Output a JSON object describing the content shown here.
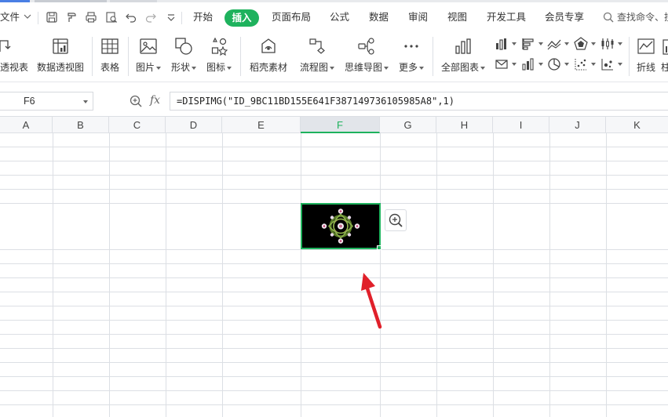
{
  "menu": {
    "file": "文件",
    "tabs": [
      "开始",
      "插入",
      "页面布局",
      "公式",
      "数据",
      "审阅",
      "视图",
      "开发工具",
      "会员专享"
    ],
    "active_tab": "插入",
    "search": "查找命令、搜"
  },
  "ribbon": {
    "pivot_table": "透视表",
    "pivot_chart": "数据透视图",
    "table": "表格",
    "picture": "图片",
    "shape": "形状",
    "icon": "图标",
    "stock_material": "稻壳素材",
    "flowchart": "流程图",
    "mindmap": "思维导图",
    "more": "更多",
    "all_charts": "全部图表",
    "line": "折线",
    "cut_off": "柱"
  },
  "formula_bar": {
    "name_box": "F6",
    "fx": "fx",
    "formula": "=DISPIMG(\"ID_9BC11BD155E641F387149736105985A8\",1)"
  },
  "sheet": {
    "columns": [
      "A",
      "B",
      "C",
      "D",
      "E",
      "F",
      "G",
      "H",
      "I",
      "J",
      "K"
    ],
    "selected_column": "F",
    "selected_cell": "F6"
  },
  "colors": {
    "accent": "#1eb25d",
    "arrow": "#e0202a",
    "grid": "#dcdfe4"
  }
}
